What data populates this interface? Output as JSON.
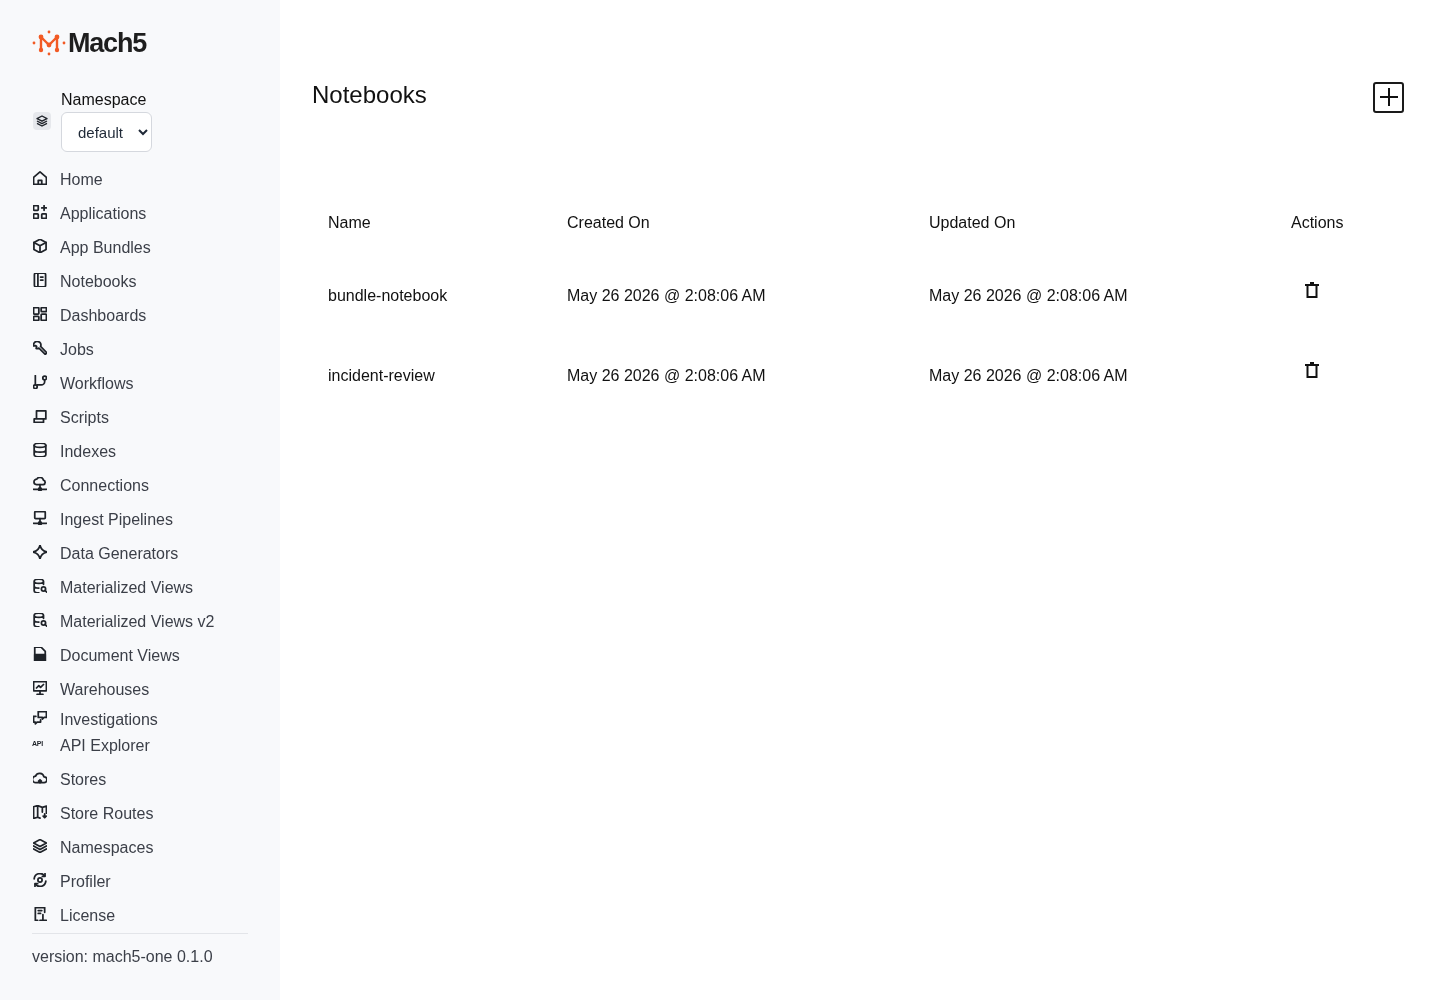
{
  "brand": {
    "name": "Mach5"
  },
  "namespace": {
    "label": "Namespace",
    "value": "default"
  },
  "nav": [
    {
      "label": "Home",
      "kind": "item"
    },
    {
      "label": "Applications",
      "kind": "item"
    },
    {
      "label": "App Bundles",
      "kind": "item"
    },
    {
      "label": "Notebooks",
      "kind": "item"
    },
    {
      "label": "Dashboards",
      "kind": "item"
    },
    {
      "label": "Jobs",
      "kind": "item"
    },
    {
      "label": "Workflows",
      "kind": "item"
    },
    {
      "label": "Scripts",
      "kind": "item"
    },
    {
      "label": "Indexes",
      "kind": "item"
    },
    {
      "label": "Connections",
      "kind": "item"
    },
    {
      "label": "Ingest Pipelines",
      "kind": "item"
    },
    {
      "label": "Data Generators",
      "kind": "item"
    },
    {
      "label": "Materialized Views",
      "kind": "item"
    },
    {
      "label": "Materialized Views v2",
      "kind": "item"
    },
    {
      "label": "Document Views",
      "kind": "item"
    },
    {
      "label": "Warehouses",
      "kind": "item"
    },
    {
      "label": "Investigations",
      "kind": "tight"
    },
    {
      "label": "API Explorer",
      "kind": "item",
      "icon_text": "API"
    },
    {
      "label": "Stores",
      "kind": "item"
    },
    {
      "label": "Store Routes",
      "kind": "item"
    },
    {
      "label": "Namespaces",
      "kind": "item"
    },
    {
      "label": "Profiler",
      "kind": "item"
    },
    {
      "label": "License",
      "kind": "item"
    }
  ],
  "version": "version: mach5-one 0.1.0",
  "page": {
    "title": "Notebooks"
  },
  "table": {
    "columns": [
      "Name",
      "Created On",
      "Updated On",
      "Actions"
    ],
    "rows": [
      {
        "name": "bundle-notebook",
        "created_on": "May 26 2026 @ 2:08:06 AM",
        "updated_on": "May 26 2026 @ 2:08:06 AM"
      },
      {
        "name": "incident-review",
        "created_on": "May 26 2026 @ 2:08:06 AM",
        "updated_on": "May 26 2026 @ 2:08:06 AM"
      }
    ]
  }
}
